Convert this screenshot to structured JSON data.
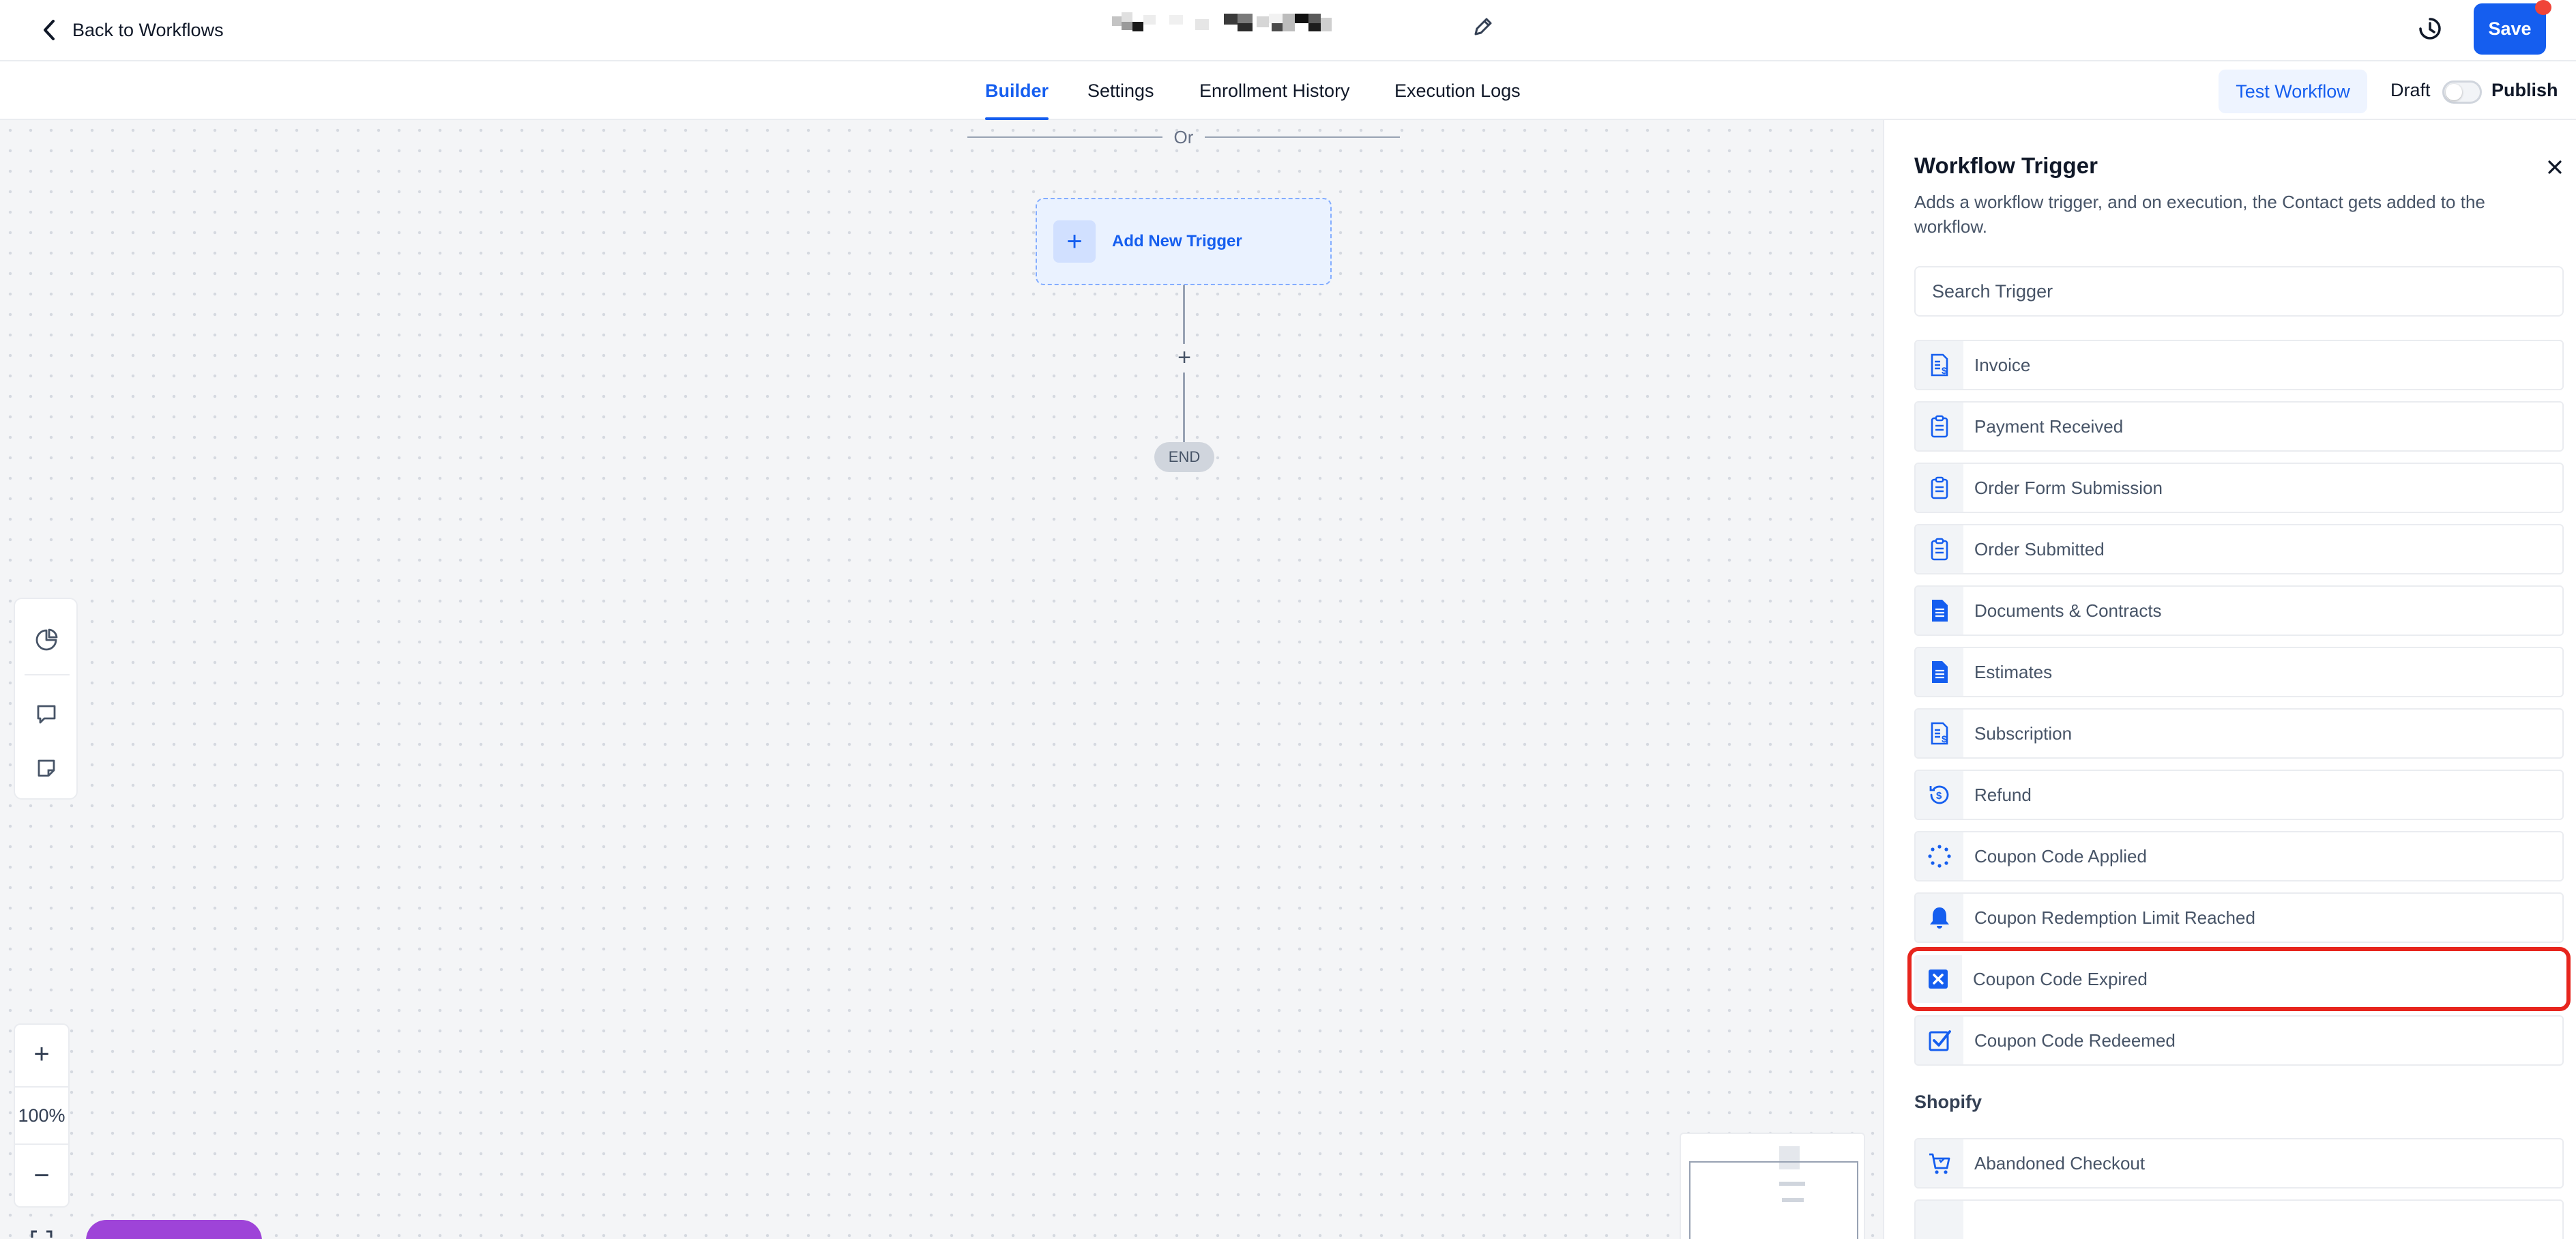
{
  "header": {
    "back_label": "Back to Workflows",
    "save_label": "Save"
  },
  "tabs": [
    {
      "label": "Builder",
      "active": true
    },
    {
      "label": "Settings",
      "active": false
    },
    {
      "label": "Enrollment History",
      "active": false
    },
    {
      "label": "Execution Logs",
      "active": false
    }
  ],
  "actions": {
    "test_workflow_label": "Test Workflow",
    "draft_label": "Draft",
    "publish_label": "Publish",
    "published": false
  },
  "canvas": {
    "or_label": "Or",
    "add_trigger_label": "Add New Trigger",
    "add_step_symbol": "+",
    "end_label": "END",
    "zoom_in_symbol": "+",
    "zoom_level": "100%",
    "zoom_out_symbol": "−"
  },
  "panel": {
    "title": "Workflow Trigger",
    "description": "Adds a workflow trigger, and on execution, the Contact gets added to the workflow.",
    "search_placeholder": "Search Trigger",
    "triggers": [
      {
        "label": "Invoice",
        "icon": "invoice-icon"
      },
      {
        "label": "Payment Received",
        "icon": "clipboard-icon"
      },
      {
        "label": "Order Form Submission",
        "icon": "clipboard-icon"
      },
      {
        "label": "Order Submitted",
        "icon": "clipboard-icon"
      },
      {
        "label": "Documents & Contracts",
        "icon": "document-icon"
      },
      {
        "label": "Estimates",
        "icon": "document-icon"
      },
      {
        "label": "Subscription",
        "icon": "invoice-icon"
      },
      {
        "label": "Refund",
        "icon": "refund-icon"
      },
      {
        "label": "Coupon Code Applied",
        "icon": "dotted-circle-icon"
      },
      {
        "label": "Coupon Redemption Limit Reached",
        "icon": "bell-icon"
      },
      {
        "label": "Coupon Code Expired",
        "icon": "x-square-icon",
        "highlighted": true
      },
      {
        "label": "Coupon Code Redeemed",
        "icon": "check-square-icon"
      }
    ],
    "section_shopify": "Shopify",
    "shopify_triggers": [
      {
        "label": "Abandoned Checkout",
        "icon": "cart-icon"
      }
    ]
  },
  "colors": {
    "accent": "#155eef",
    "highlight_border": "#e7251d",
    "notification_dot": "#f04438"
  }
}
